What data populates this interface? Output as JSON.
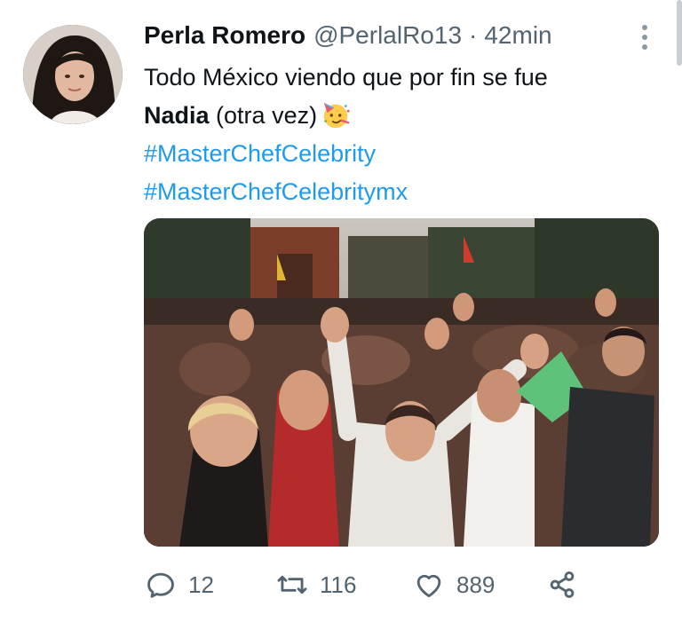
{
  "tweet": {
    "author_name": "Perla Romero",
    "author_handle": "@PerlalRo13",
    "separator": "·",
    "timestamp": "42min",
    "text_line1": "Todo México viendo que por fin se fue",
    "text_bold": "Nadia",
    "text_line2_rest": "(otra vez)",
    "emoji": "partying-face-emoji",
    "hashtags": [
      "#MasterChefCelebrity",
      "#MasterChefCelebritymx"
    ]
  },
  "actions": {
    "replies": "12",
    "retweets": "116",
    "likes": "889",
    "icons": [
      "reply-icon",
      "retweet-icon",
      "like-icon",
      "share-icon"
    ]
  },
  "colors": {
    "link": "#1d9bf0",
    "secondary_text": "#536471",
    "primary_text": "#0f1419"
  }
}
